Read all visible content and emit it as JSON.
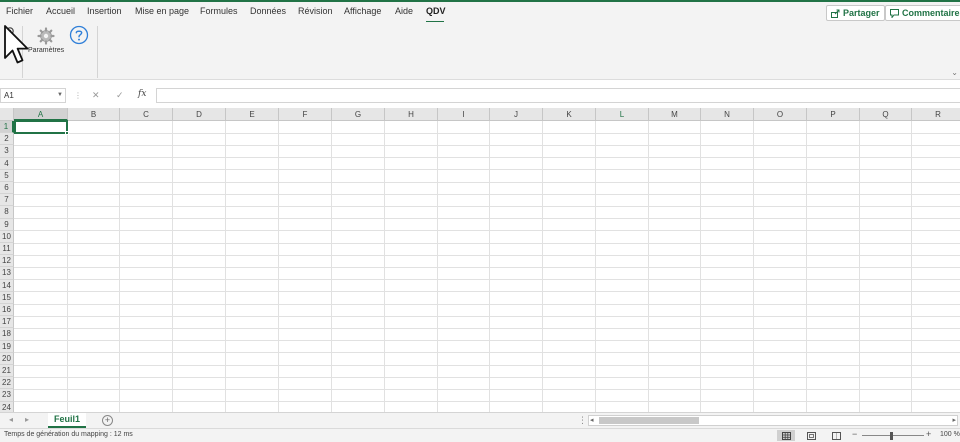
{
  "menu": {
    "items": [
      "Fichier",
      "Accueil",
      "Insertion",
      "Mise en page",
      "Formules",
      "Données",
      "Révision",
      "Affichage",
      "Aide",
      "QDV"
    ],
    "active": "QDV",
    "share_label": "Partager",
    "comments_label": "Commentaires"
  },
  "ribbon": {
    "settings_label": "Paramètres",
    "help_icon": "help-icon",
    "settings_icon": "gear-icon"
  },
  "formula_bar": {
    "name_box": "A1",
    "fx_label": "fx",
    "value": ""
  },
  "grid": {
    "columns": [
      "A",
      "B",
      "C",
      "D",
      "E",
      "F",
      "G",
      "H",
      "I",
      "J",
      "K",
      "L",
      "M",
      "N",
      "O",
      "P",
      "Q",
      "R"
    ],
    "rows": [
      "1",
      "2",
      "3",
      "4",
      "5",
      "6",
      "7",
      "8",
      "9",
      "10",
      "11",
      "12",
      "13",
      "14",
      "15",
      "16",
      "17",
      "18",
      "19",
      "20",
      "21",
      "22",
      "23",
      "24"
    ],
    "active_cell": "A1"
  },
  "sheets": {
    "tabs": [
      "Feuil1"
    ],
    "active": "Feuil1",
    "add_label": "+"
  },
  "status_bar": {
    "message": "Temps de génération du mapping : 12 ms",
    "zoom": "100 %"
  },
  "colors": {
    "accent": "#217346",
    "ribbon_bg": "#f3f3f3",
    "header_bg": "#e6e6e6"
  }
}
